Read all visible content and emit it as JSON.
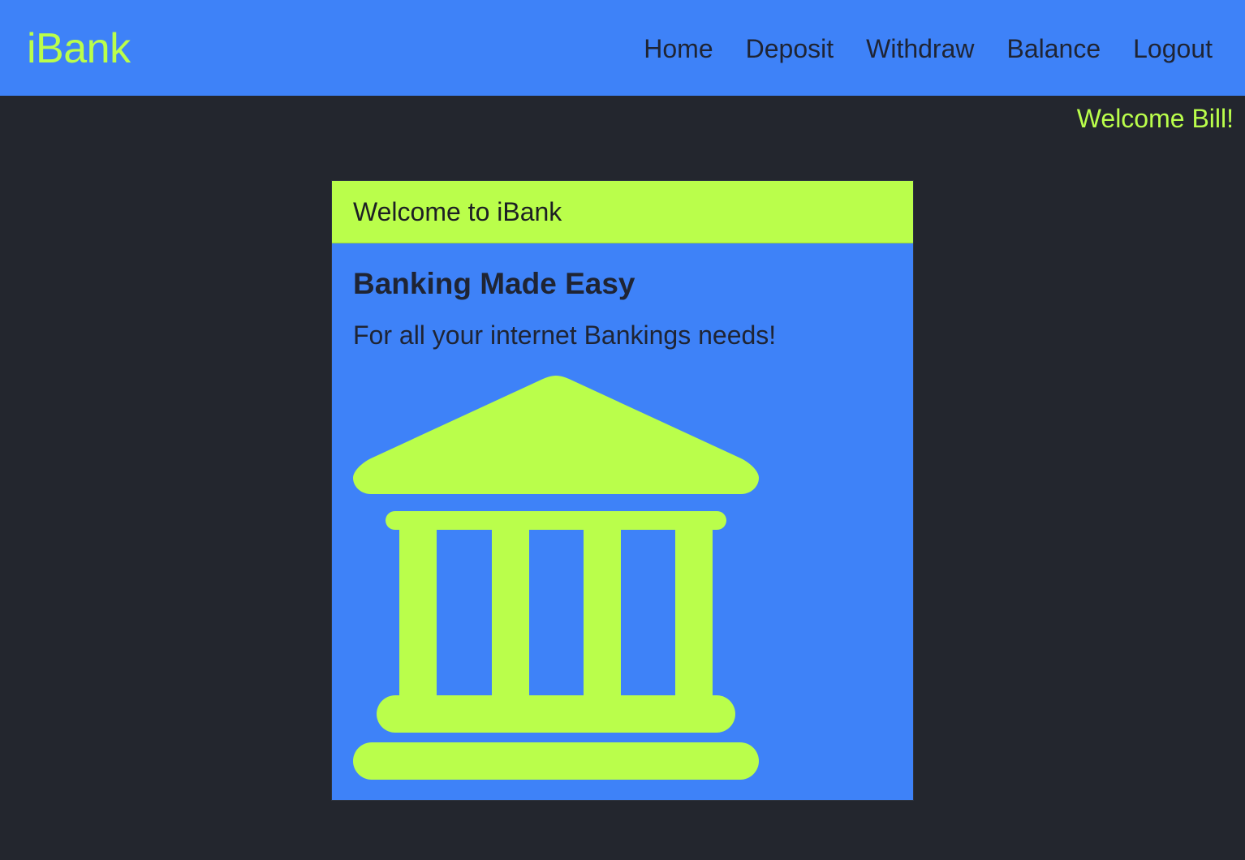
{
  "app": {
    "brand": "iBank"
  },
  "nav": {
    "items": [
      {
        "label": "Home"
      },
      {
        "label": "Deposit"
      },
      {
        "label": "Withdraw"
      },
      {
        "label": "Balance"
      },
      {
        "label": "Logout"
      }
    ]
  },
  "user": {
    "welcome_text": "Welcome Bill!"
  },
  "card": {
    "header": "Welcome to iBank",
    "title": "Banking Made Easy",
    "text": "For all your internet Bankings needs!",
    "icon": "bank-icon"
  },
  "colors": {
    "navbar_bg": "#3e82f8",
    "accent": "#bafe4b",
    "page_bg": "#23262e",
    "text_dark": "#1f2433"
  }
}
